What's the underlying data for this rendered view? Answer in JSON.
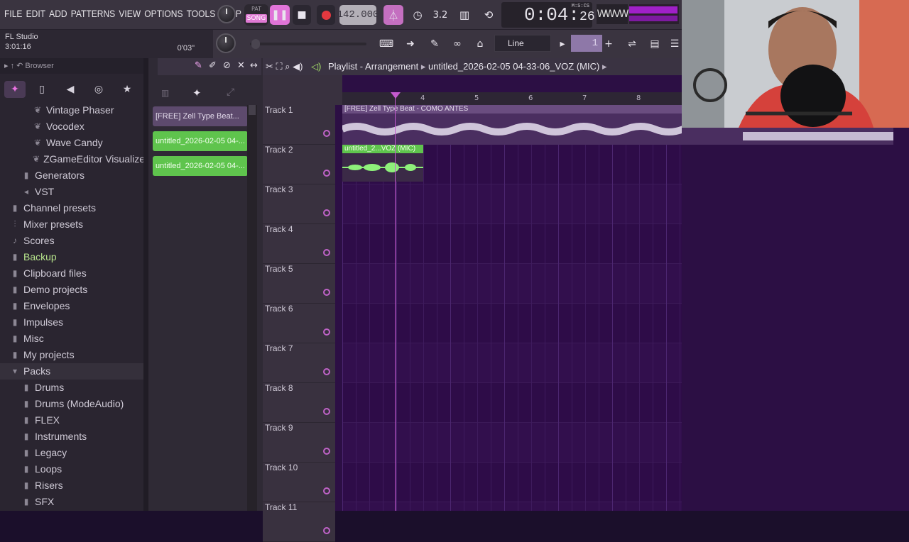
{
  "menu": [
    "FILE",
    "EDIT",
    "ADD",
    "PATTERNS",
    "VIEW",
    "OPTIONS",
    "TOOLS",
    "HELP"
  ],
  "transport": {
    "pat_label": "PAT",
    "song_label": "SONG",
    "play_icon": "pause-icon",
    "tempo": "142.000",
    "time_main": "0:04:",
    "time_cs": "26",
    "time_mode": "M:S:CS"
  },
  "hint_panel": {
    "app_name": "FL Studio",
    "total_time": "3:01:16",
    "position": "0'03\""
  },
  "snap": {
    "value": "Line"
  },
  "pattern_selector": {
    "value": "1"
  },
  "browser": {
    "title": "Browser",
    "items": [
      {
        "label": "Vintage Phaser",
        "indent": 3,
        "icon": "plugin-icon"
      },
      {
        "label": "Vocodex",
        "indent": 3,
        "icon": "plugin-icon"
      },
      {
        "label": "Wave Candy",
        "indent": 3,
        "icon": "plugin-icon"
      },
      {
        "label": "ZGameEditor Visualizer",
        "indent": 3,
        "icon": "plugin-icon"
      },
      {
        "label": "Generators",
        "indent": 2,
        "icon": "folder-icon"
      },
      {
        "label": "VST",
        "indent": 2,
        "icon": "plug-icon"
      },
      {
        "label": "Channel presets",
        "indent": 1,
        "icon": "folder-icon"
      },
      {
        "label": "Mixer presets",
        "indent": 1,
        "icon": "mixer-icon"
      },
      {
        "label": "Scores",
        "indent": 1,
        "icon": "note-icon"
      },
      {
        "label": "Backup",
        "indent": 1,
        "icon": "folder-icon",
        "green": true
      },
      {
        "label": "Clipboard files",
        "indent": 1,
        "icon": "folder-icon"
      },
      {
        "label": "Demo projects",
        "indent": 1,
        "icon": "folder-icon"
      },
      {
        "label": "Envelopes",
        "indent": 1,
        "icon": "folder-icon"
      },
      {
        "label": "Impulses",
        "indent": 1,
        "icon": "folder-icon"
      },
      {
        "label": "Misc",
        "indent": 1,
        "icon": "folder-icon"
      },
      {
        "label": "My projects",
        "indent": 1,
        "icon": "folder-icon"
      },
      {
        "label": "Packs",
        "indent": 1,
        "icon": "folder-open-icon",
        "selected": true
      },
      {
        "label": "Drums",
        "indent": 2,
        "icon": "folder-icon"
      },
      {
        "label": "Drums (ModeAudio)",
        "indent": 2,
        "icon": "folder-icon"
      },
      {
        "label": "FLEX",
        "indent": 2,
        "icon": "folder-icon"
      },
      {
        "label": "Instruments",
        "indent": 2,
        "icon": "folder-icon"
      },
      {
        "label": "Legacy",
        "indent": 2,
        "icon": "folder-icon"
      },
      {
        "label": "Loops",
        "indent": 2,
        "icon": "folder-icon"
      },
      {
        "label": "Risers",
        "indent": 2,
        "icon": "folder-icon"
      },
      {
        "label": "SFX",
        "indent": 2,
        "icon": "folder-icon"
      }
    ]
  },
  "picker": {
    "clips": [
      {
        "label": "[FREE] Zell Type Beat...",
        "color": "#5d4a6d"
      },
      {
        "label": "untitled_2026-02-05 04-...",
        "color": "#5fc44d"
      },
      {
        "label": "untitled_2026-02-05 04-...",
        "color": "#5fc44d"
      }
    ]
  },
  "playlist": {
    "title": "Playlist - Arrangement",
    "project": "untitled_2026-02-05 04-33-06_VOZ (MIC)",
    "ruler": [
      "4",
      "5",
      "6",
      "7",
      "8"
    ],
    "tracks": [
      "Track 1",
      "Track 2",
      "Track 3",
      "Track 4",
      "Track 5",
      "Track 6",
      "Track 7",
      "Track 8",
      "Track 9",
      "Track 10",
      "Track 11"
    ],
    "clip1_label": "[FREE] Zell Type Beat - COMO ANTES",
    "clip2_label": "untitled_2...VOZ (MIC)"
  },
  "colors": {
    "accent": "#e074d8",
    "playlist_bg": "#320f4d",
    "audio_green": "#5fc44d"
  }
}
